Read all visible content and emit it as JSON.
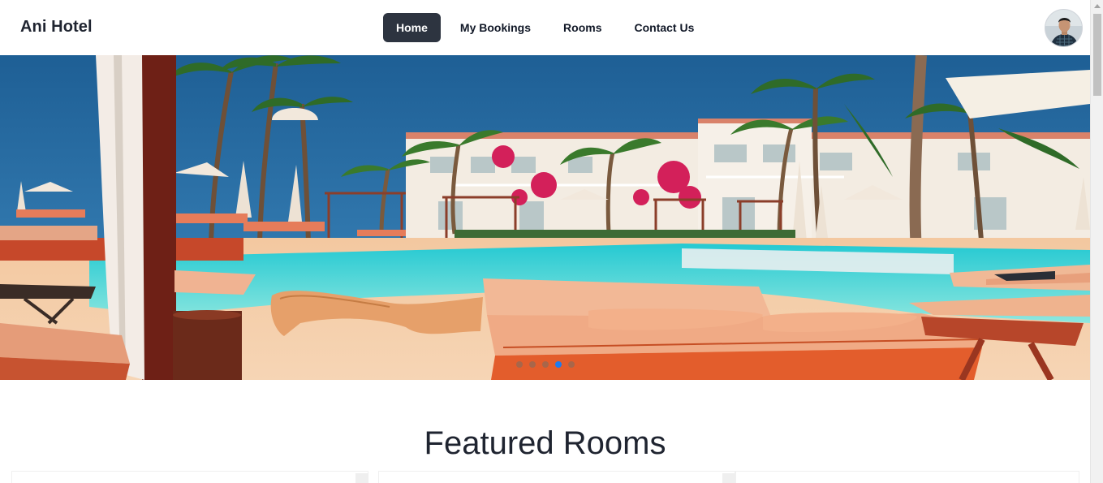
{
  "navbar": {
    "brand": "Ani Hotel",
    "items": [
      {
        "label": "Home",
        "active": true
      },
      {
        "label": "My Bookings",
        "active": false
      },
      {
        "label": "Rooms",
        "active": false
      },
      {
        "label": "Contact Us",
        "active": false
      }
    ],
    "avatar_icon": "user-avatar"
  },
  "hero": {
    "slide_count": 5,
    "active_slide": 4,
    "image_subject": "resort pool with sun loungers and palm trees",
    "indicator_active_color": "#1d7bf0"
  },
  "featured": {
    "title": "Featured Rooms"
  },
  "colors": {
    "nav_active_bg": "#2d3440",
    "text_dark": "#1f2430"
  }
}
